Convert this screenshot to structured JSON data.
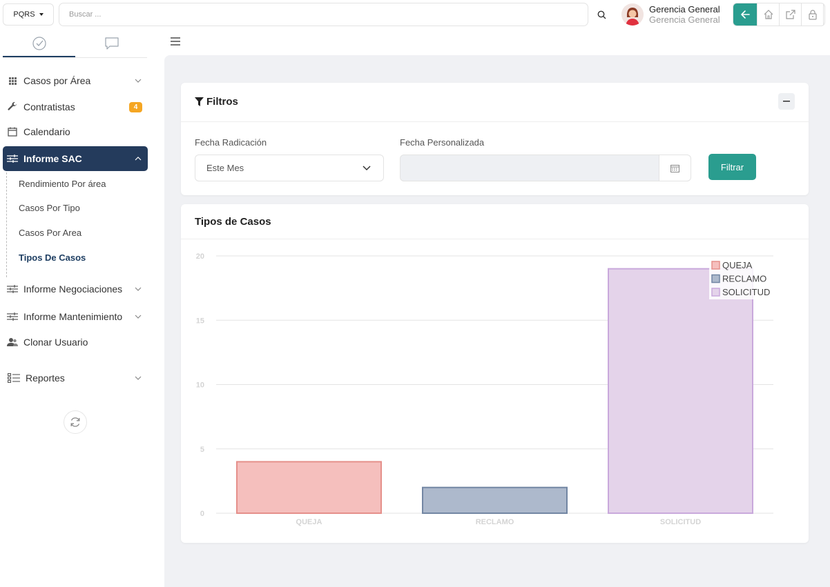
{
  "topbar": {
    "app_select": "PQRS",
    "search_placeholder": "Buscar ...",
    "user_name": "Gerencia General",
    "user_role": "Gerencia General"
  },
  "sidebar": {
    "items": [
      {
        "label": "Casos por Área",
        "icon": "grid-icon"
      },
      {
        "label": "Contratistas",
        "icon": "wrench-icon",
        "badge": "4"
      },
      {
        "label": "Calendario",
        "icon": "calendar-icon"
      },
      {
        "label": "Informe SAC",
        "icon": "sliders-icon"
      },
      {
        "label": "Informe Negociaciones",
        "icon": "sliders-icon"
      },
      {
        "label": "Informe Mantenimiento",
        "icon": "sliders-icon"
      },
      {
        "label": "Clonar Usuario",
        "icon": "users-icon"
      },
      {
        "label": "Reportes",
        "icon": "list-icon"
      }
    ],
    "submenu": [
      "Rendimiento Por área",
      "Casos Por Tipo",
      "Casos Por Area",
      "Tipos De Casos"
    ]
  },
  "filters": {
    "title": "Filtros",
    "fecha_radicacion_label": "Fecha Radicación",
    "fecha_radicacion_value": "Este Mes",
    "fecha_personalizada_label": "Fecha Personalizada",
    "button": "Filtrar"
  },
  "chart_card": {
    "title": "Tipos de Casos"
  },
  "chart_data": {
    "type": "bar",
    "categories": [
      "QUEJA",
      "RECLAMO",
      "SOLICITUD"
    ],
    "values": [
      4,
      2,
      19
    ],
    "ylim": [
      0,
      20
    ],
    "yticks": [
      0,
      5,
      10,
      15,
      20
    ],
    "grid": true,
    "legend": "top-right",
    "legend_entries": [
      "QUEJA",
      "RECLAMO",
      "SOLICITUD"
    ],
    "colors": {
      "fill": [
        "#f5bfbd",
        "#adb9cc",
        "#e4d3ea"
      ],
      "stroke": [
        "#e58f8a",
        "#7286a3",
        "#c9a9dc"
      ]
    }
  }
}
